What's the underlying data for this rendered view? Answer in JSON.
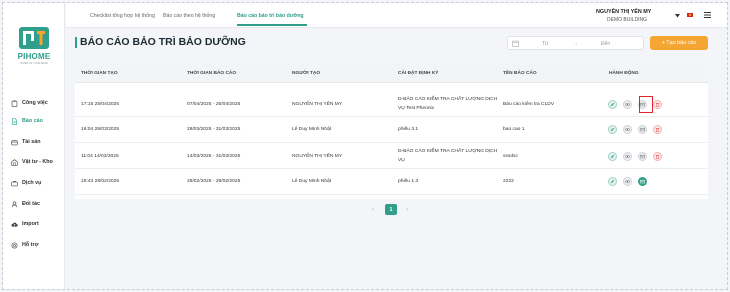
{
  "brand": {
    "name": "PIHOME",
    "tagline": "HOME OF YOUR MIND"
  },
  "colors": {
    "accent": "#2f9e8a",
    "create": "#f5a531",
    "highlight": "#e0242b"
  },
  "sidebar": {
    "items": [
      {
        "label": "Công việc",
        "icon": "clipboard-icon"
      },
      {
        "label": "Báo cáo",
        "icon": "document-icon"
      },
      {
        "label": "Tài sản",
        "icon": "box-icon"
      },
      {
        "label": "Vật tư - Kho",
        "icon": "warehouse-icon"
      },
      {
        "label": "Dịch vụ",
        "icon": "briefcase-icon"
      },
      {
        "label": "Đối tác",
        "icon": "user-icon"
      },
      {
        "label": "Import",
        "icon": "cloud-upload-icon"
      },
      {
        "label": "Hỗ trợ",
        "icon": "support-icon"
      }
    ]
  },
  "tabs": [
    {
      "label": "Checklist tổng hợp hệ thống"
    },
    {
      "label": "Báo cáo theo hệ thống"
    },
    {
      "label": "Báo cáo bảo trì bảo dưỡng"
    }
  ],
  "user": {
    "name": "NGUYỄN THỊ YẾN MY",
    "building": "DEMO BUILDING"
  },
  "page": {
    "title": "BÁO CÁO BẢO TRÌ BẢO DƯỠNG",
    "date_from": "Từ",
    "date_arrow": "→",
    "date_to": "Đến",
    "create_label": "+ Tạo báo cáo"
  },
  "table": {
    "headers": [
      "THỜI GIAN TẠO",
      "THỜI GIAN BÁO CÁO",
      "NGƯỜI TẠO",
      "CÀI ĐẶT ĐỊNH KỲ",
      "TÊN BÁO CÁO",
      "HÀNH ĐỘNG"
    ],
    "rows": [
      {
        "created": "17:15 25/04/2025",
        "period": "07/04/2025 - 25/04/2025",
        "creator": "NGUYỄN THỊ YẾN MY",
        "schedule1": "D-BÁO CÁO KIỂM TRA CHẤT LƯỢNG DỊCH",
        "schedule2": "VỤ Test Pheonix",
        "name": "Báo cáo kiểm tra CLDV"
      },
      {
        "created": "16:04 28/03/2025",
        "period": "28/03/2025 - 31/03/2025",
        "creator": "Lê Duy Minh Nhật",
        "schedule1": "phiếu 3.1",
        "schedule2": "",
        "name": "bao cao 1"
      },
      {
        "created": "11:04 14/03/2025",
        "period": "14/03/2025 - 31/03/2025",
        "creator": "NGUYỄN THỊ YẾN MY",
        "schedule1": "D-BÁO CÁO KIỂM TRA CHẤT LƯỢNG DỊCH",
        "schedule2": "VỤ",
        "name": "sssdsc"
      },
      {
        "created": "18:43 28/02/2025",
        "period": "28/02/2025 - 28/02/2025",
        "creator": "Lê Duy Minh Nhật",
        "schedule1": "phiếu 1.3",
        "schedule2": "",
        "name": "2222"
      }
    ]
  },
  "pagination": {
    "prev": "‹",
    "current": "1",
    "next": "›"
  }
}
